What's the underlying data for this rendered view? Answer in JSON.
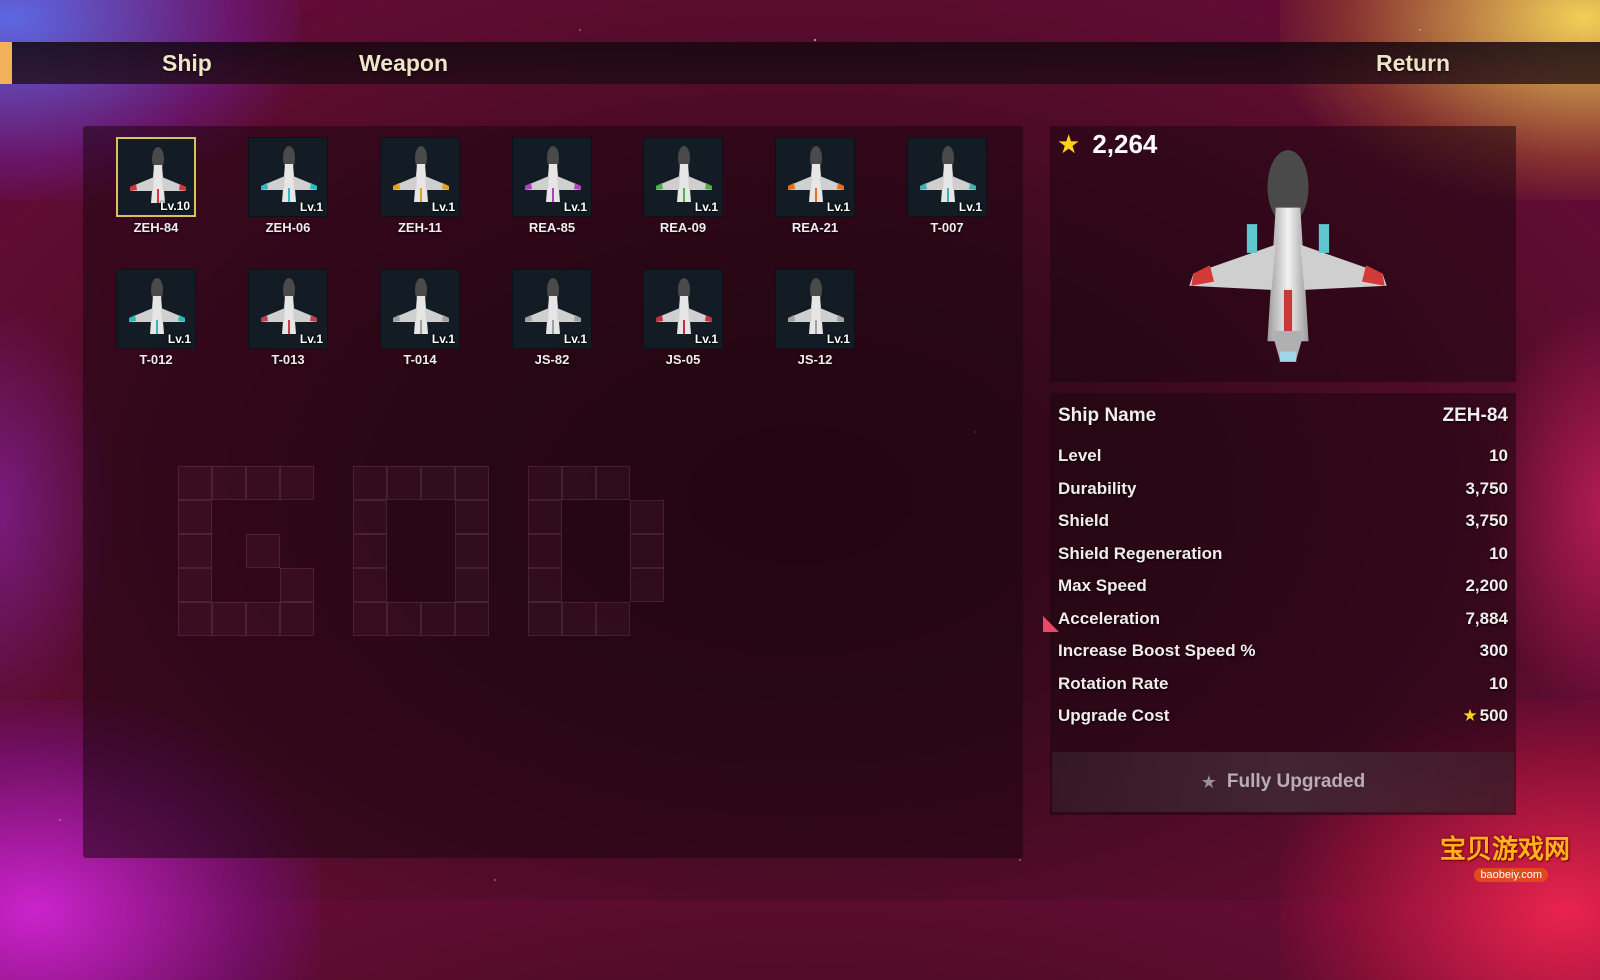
{
  "topbar": {
    "tabs": [
      {
        "label": "Ship"
      },
      {
        "label": "Weapon"
      }
    ],
    "return_label": "Return"
  },
  "credits": {
    "value": "2,264",
    "icon": "star-icon"
  },
  "ships": [
    {
      "name": "ZEH-84",
      "level": "Lv.10",
      "selected": true,
      "accent": "#d8323a"
    },
    {
      "name": "ZEH-06",
      "level": "Lv.1",
      "selected": false,
      "accent": "#2fb8c8"
    },
    {
      "name": "ZEH-11",
      "level": "Lv.1",
      "selected": false,
      "accent": "#e0a020"
    },
    {
      "name": "REA-85",
      "level": "Lv.1",
      "selected": false,
      "accent": "#b040c0"
    },
    {
      "name": "REA-09",
      "level": "Lv.1",
      "selected": false,
      "accent": "#50b050"
    },
    {
      "name": "REA-21",
      "level": "Lv.1",
      "selected": false,
      "accent": "#e07020"
    },
    {
      "name": "T-007",
      "level": "Lv.1",
      "selected": false,
      "accent": "#40b0b0"
    },
    {
      "name": "T-012",
      "level": "Lv.1",
      "selected": false,
      "accent": "#30b8c0"
    },
    {
      "name": "T-013",
      "level": "Lv.1",
      "selected": false,
      "accent": "#c04050"
    },
    {
      "name": "T-014",
      "level": "Lv.1",
      "selected": false,
      "accent": "#a0a0a0"
    },
    {
      "name": "JS-82",
      "level": "Lv.1",
      "selected": false,
      "accent": "#a0a0a0"
    },
    {
      "name": "JS-05",
      "level": "Lv.1",
      "selected": false,
      "accent": "#c03040"
    },
    {
      "name": "JS-12",
      "level": "Lv.1",
      "selected": false,
      "accent": "#a0a0a0"
    }
  ],
  "stats": {
    "header": {
      "label": "Ship Name",
      "value": "ZEH-84"
    },
    "rows": [
      {
        "label": "Level",
        "value": "10"
      },
      {
        "label": "Durability",
        "value": "3,750"
      },
      {
        "label": "Shield",
        "value": "3,750"
      },
      {
        "label": "Shield Regeneration",
        "value": "10"
      },
      {
        "label": "Max Speed",
        "value": "2,200"
      },
      {
        "label": "Acceleration",
        "value": "7,884"
      },
      {
        "label": "Increase Boost Speed %",
        "value": "300"
      },
      {
        "label": "Rotation Rate",
        "value": "10"
      },
      {
        "label": "Upgrade Cost",
        "value": "500",
        "icon": "star-icon"
      }
    ]
  },
  "upgrade_button": {
    "label": "Fully Upgraded",
    "icon": "star-icon"
  },
  "watermark": {
    "text": "宝贝游戏网",
    "sub": "baobeiy.com"
  },
  "colors": {
    "accent_tab": "#f2b15a",
    "gold": "#ffd21a",
    "selected_border": "#d8c35a"
  }
}
